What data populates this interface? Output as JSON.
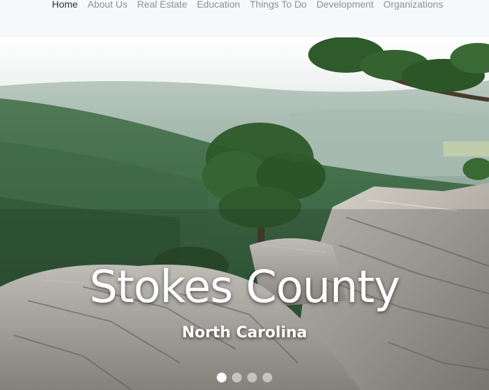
{
  "nav": {
    "items": [
      {
        "label": "Home",
        "active": true
      },
      {
        "label": "About Us",
        "active": false
      },
      {
        "label": "Real Estate",
        "active": false
      },
      {
        "label": "Education",
        "active": false
      },
      {
        "label": "Things To Do",
        "active": false
      },
      {
        "label": "Development",
        "active": false
      },
      {
        "label": "Organizations",
        "active": false
      }
    ]
  },
  "hero": {
    "title": "Stokes County",
    "subtitle": "North Carolina",
    "slide_count": 4,
    "active_slide": 1
  },
  "colors": {
    "nav_text": "#8a8f96",
    "nav_active": "#2b2f33",
    "caption_text": "#ffffff"
  }
}
